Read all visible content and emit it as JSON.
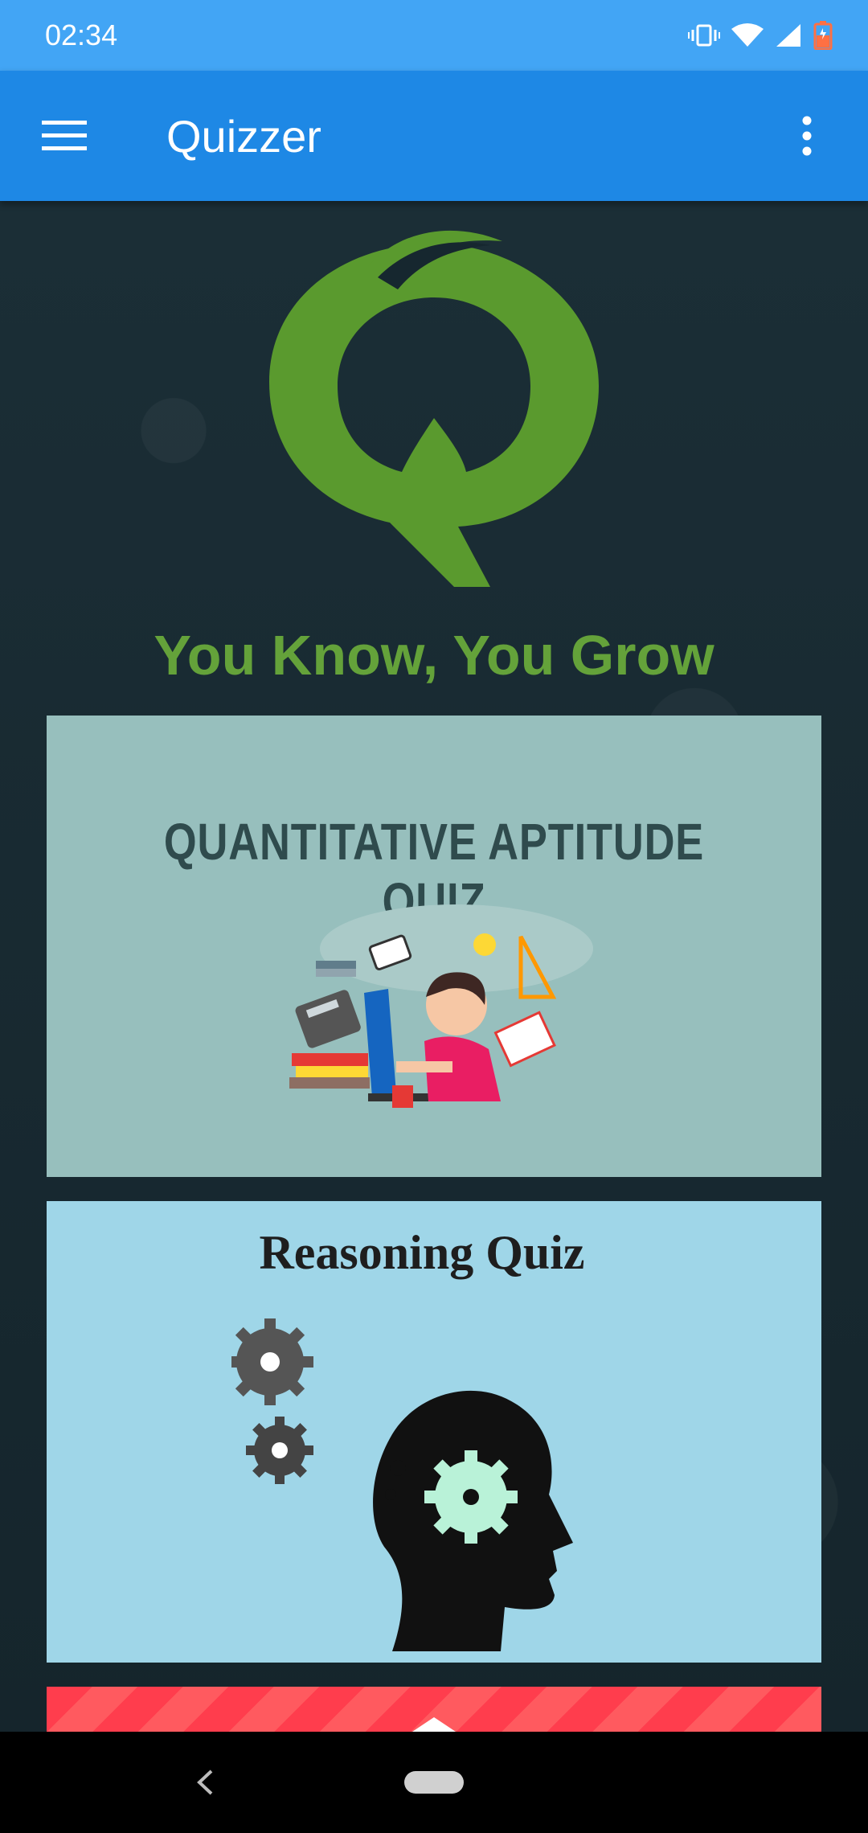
{
  "status_bar": {
    "time": "02:34",
    "icons": [
      "vibrate-icon",
      "wifi-icon",
      "signal-icon",
      "battery-icon"
    ]
  },
  "app_bar": {
    "title": "Quizzer",
    "menu_icon": "hamburger-menu-icon",
    "overflow_icon": "more-vert-icon"
  },
  "main": {
    "logo": "Q",
    "tagline": "You Know, You Grow",
    "quiz_cards": [
      {
        "title": "QUANTITATIVE APTITUDE QUIZ"
      },
      {
        "title": "Reasoning Quiz"
      },
      {
        "title": ""
      }
    ]
  },
  "colors": {
    "status_bar": "#42a5f5",
    "app_bar": "#1e88e5",
    "logo_green": "#5a9a2e",
    "tagline_green": "#64a23a",
    "quant_card_bg": "#97bfbd",
    "reasoning_card_bg": "#9fd6e8",
    "third_card_bg": "#ff3d4d"
  },
  "nav_bar": {
    "icons": [
      "back-icon",
      "home-pill-icon"
    ]
  }
}
